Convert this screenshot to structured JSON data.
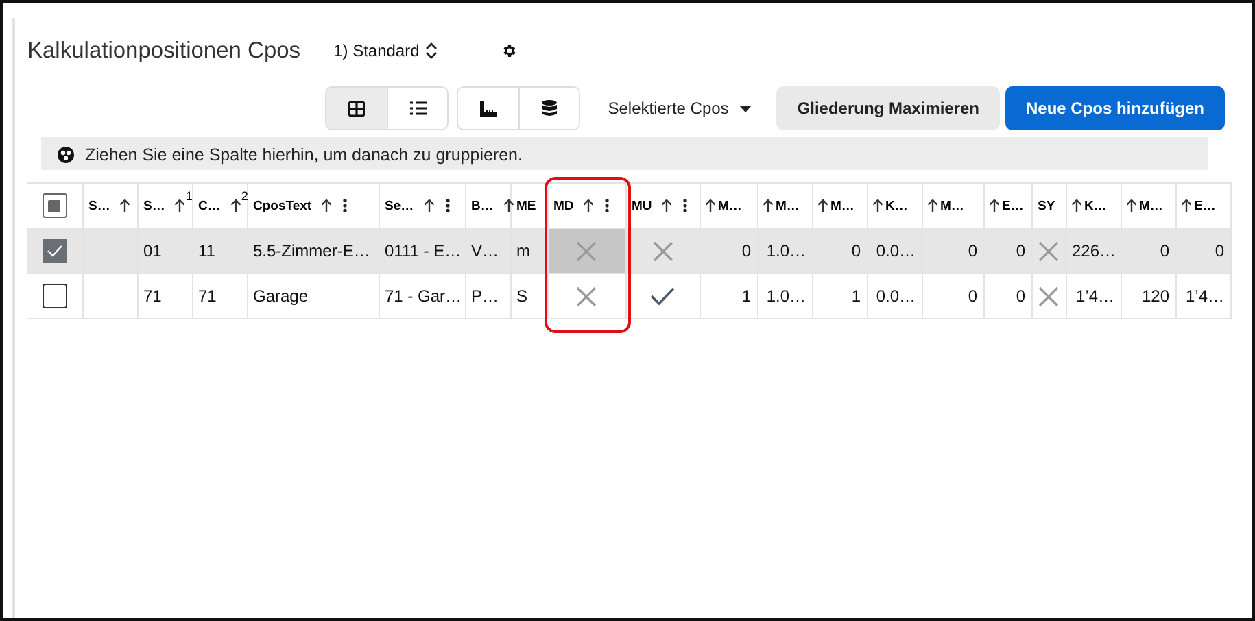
{
  "title": "Kalkulationpositionen Cpos",
  "layout_select": {
    "label": "1) Standard"
  },
  "view_toggles": [
    {
      "kind": "grid",
      "selected": true
    },
    {
      "kind": "list",
      "selected": false
    }
  ],
  "tool_toggles": [
    {
      "kind": "ruler",
      "selected": false
    },
    {
      "kind": "database",
      "selected": false
    }
  ],
  "selection_menu": {
    "label": "Selektierte Cpos"
  },
  "buttons": [
    {
      "label": "Gliederung Maximieren",
      "kind": "secondary"
    },
    {
      "label": "Neue Cpos hinzufügen",
      "kind": "primary"
    }
  ],
  "group_panel": {
    "text": "Ziehen Sie eine Spalte hierhin, um danach zu gruppieren."
  },
  "table": {
    "header_checkbox": {
      "indeterminate": true
    },
    "columns": [
      {
        "label": "S…",
        "kind": "text",
        "sortable": true,
        "menu": false,
        "annotated": false
      },
      {
        "label": "S…",
        "kind": "text",
        "sortable": true,
        "menu": false,
        "annotated": false,
        "sort_index": "1"
      },
      {
        "label": "C…",
        "kind": "text",
        "sortable": true,
        "menu": false,
        "annotated": false,
        "sort_index": "2"
      },
      {
        "label": "CposText",
        "kind": "text",
        "sortable": true,
        "menu": true,
        "annotated": false
      },
      {
        "label": "Se…",
        "kind": "text",
        "sortable": true,
        "menu": true,
        "annotated": false
      },
      {
        "label": "B…",
        "kind": "text",
        "sortable": true,
        "menu": false,
        "annotated": false
      },
      {
        "label": "ME",
        "kind": "text",
        "sortable": false,
        "menu": false,
        "annotated": false
      },
      {
        "label": "MD",
        "kind": "bool",
        "sortable": true,
        "menu": true,
        "annotated": true
      },
      {
        "label": "MU",
        "kind": "bool",
        "sortable": true,
        "menu": true,
        "annotated": false
      },
      {
        "label": "M…",
        "kind": "numeric",
        "sortable": true,
        "menu": false,
        "annotated": false
      },
      {
        "label": "M…",
        "kind": "numeric",
        "sortable": true,
        "menu": false,
        "annotated": false
      },
      {
        "label": "M…",
        "kind": "numeric",
        "sortable": true,
        "menu": false,
        "annotated": false
      },
      {
        "label": "K…",
        "kind": "numeric",
        "sortable": true,
        "menu": false,
        "annotated": false
      },
      {
        "label": "M…",
        "kind": "numeric",
        "sortable": true,
        "menu": false,
        "annotated": false
      },
      {
        "label": "E…",
        "kind": "numeric",
        "sortable": true,
        "menu": false,
        "annotated": false
      },
      {
        "label": "SY",
        "kind": "bool",
        "sortable": false,
        "menu": false,
        "annotated": false
      },
      {
        "label": "K…",
        "kind": "numeric",
        "sortable": true,
        "menu": false,
        "annotated": false
      },
      {
        "label": "M…",
        "kind": "numeric",
        "sortable": true,
        "menu": false,
        "annotated": false
      },
      {
        "label": "E…",
        "kind": "numeric",
        "sortable": true,
        "menu": false,
        "annotated": false
      }
    ],
    "rows": [
      {
        "selected": true,
        "cells": [
          "",
          "01",
          "11",
          "5.5-Zimmer-E…",
          "0111 - E…",
          "V…",
          "m",
          {
            "checked": false,
            "focused": true
          },
          {
            "checked": false,
            "focused": false
          },
          "0",
          "1.0…",
          "0",
          "0.0…",
          "0",
          "0",
          {
            "checked": false,
            "focused": false
          },
          "226…",
          "0",
          "0"
        ]
      },
      {
        "selected": false,
        "cells": [
          "",
          "71",
          "71",
          "Garage",
          "71 - Gar…",
          "P…",
          "S",
          {
            "checked": false,
            "focused": false
          },
          {
            "checked": true,
            "focused": false
          },
          "1",
          "1.0…",
          "1",
          "0.0…",
          "0",
          "0",
          {
            "checked": false,
            "focused": false
          },
          "1’4…",
          "120",
          "1’4…"
        ]
      }
    ]
  }
}
